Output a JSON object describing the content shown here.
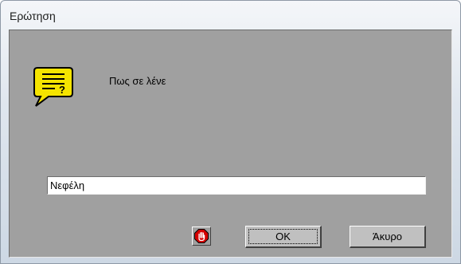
{
  "window": {
    "title": "Ερώτηση"
  },
  "dialog": {
    "prompt": "Πως σε λένε",
    "answer_value": "Νεφέλη",
    "icons": {
      "question": "question-speech-bubble-icon",
      "stop": "stop-hand-icon"
    },
    "buttons": {
      "ok_label": "OK",
      "cancel_label": "Άκυρο"
    }
  },
  "colors": {
    "client_bg": "#a0a0a0",
    "bubble_fill": "#f5e400",
    "stop_red": "#d40000"
  }
}
